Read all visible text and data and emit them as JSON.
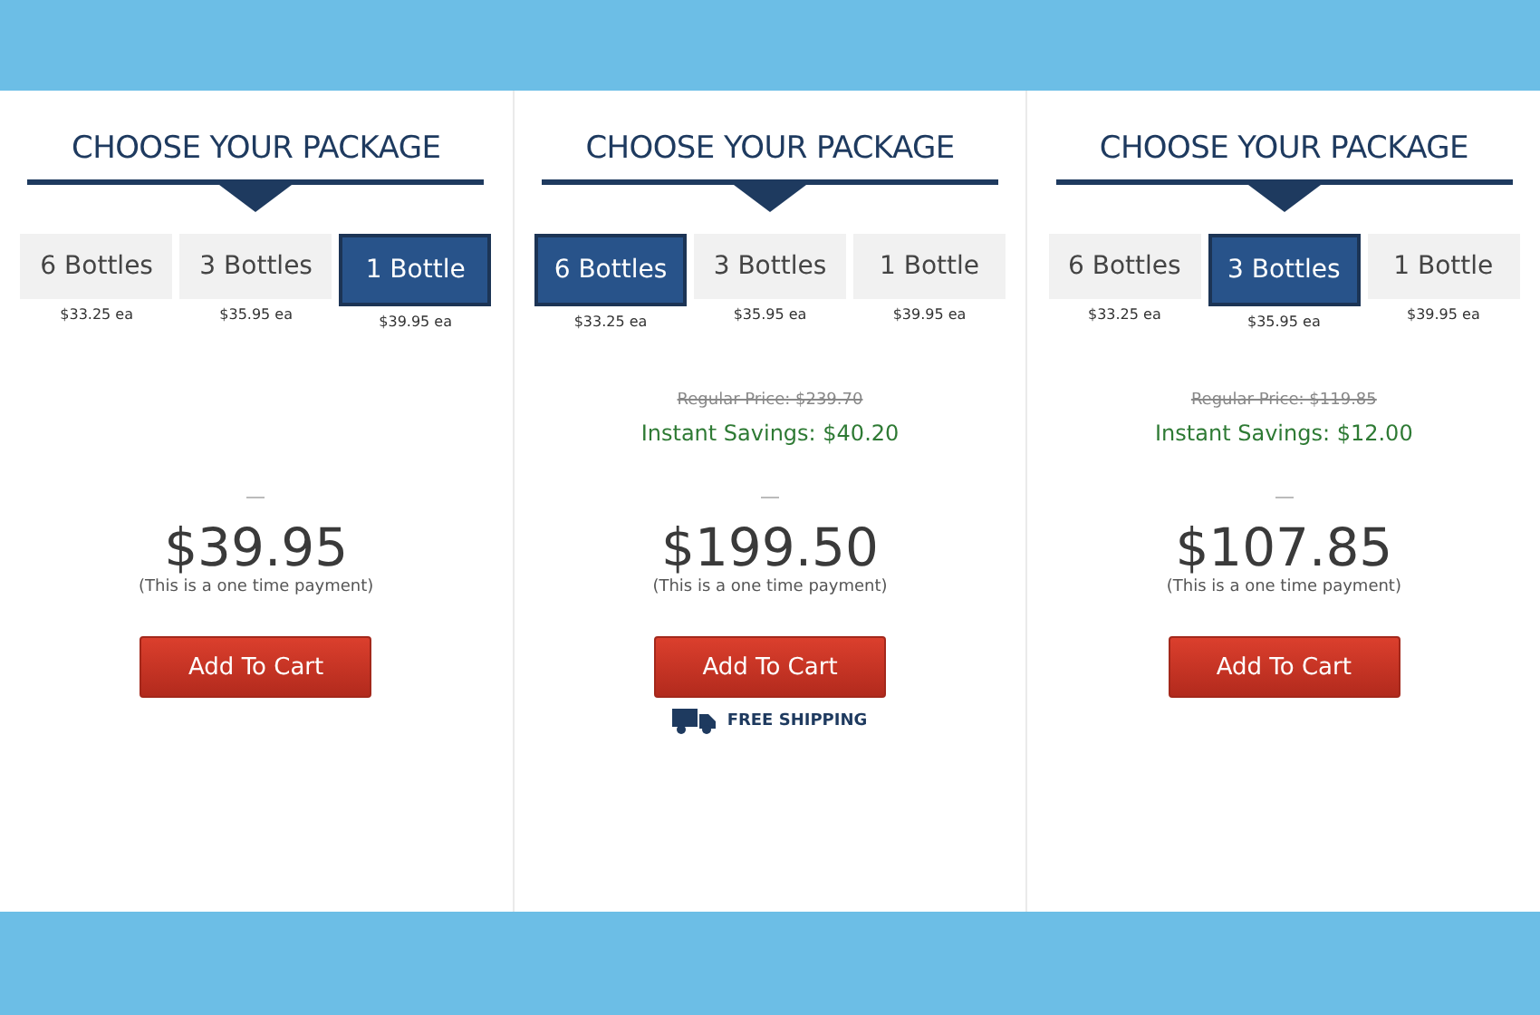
{
  "panels": [
    {
      "heading": "CHOOSE YOUR PACKAGE",
      "options": [
        {
          "label": "6 Bottles",
          "per_unit": "$33.25 ea",
          "selected": false
        },
        {
          "label": "3 Bottles",
          "per_unit": "$35.95 ea",
          "selected": false
        },
        {
          "label": "1 Bottle",
          "per_unit": "$39.95 ea",
          "selected": true
        }
      ],
      "price": "$39.95",
      "note": "(This is a one time payment)",
      "button": "Add To Cart"
    },
    {
      "heading": "CHOOSE YOUR PACKAGE",
      "options": [
        {
          "label": "6 Bottles",
          "per_unit": "$33.25 ea",
          "selected": true
        },
        {
          "label": "3 Bottles",
          "per_unit": "$35.95 ea",
          "selected": false
        },
        {
          "label": "1 Bottle",
          "per_unit": "$39.95 ea",
          "selected": false
        }
      ],
      "regular_price": "Regular Price: $239.70",
      "savings": "Instant Savings: $40.20",
      "price": "$199.50",
      "note": "(This is a one time payment)",
      "button": "Add To Cart",
      "shipping": "FREE SHIPPING"
    },
    {
      "heading": "CHOOSE YOUR PACKAGE",
      "options": [
        {
          "label": "6 Bottles",
          "per_unit": "$33.25 ea",
          "selected": false
        },
        {
          "label": "3 Bottles",
          "per_unit": "$35.95 ea",
          "selected": true
        },
        {
          "label": "1 Bottle",
          "per_unit": "$39.95 ea",
          "selected": false
        }
      ],
      "regular_price": "Regular Price: $119.85",
      "savings": "Instant Savings: $12.00",
      "price": "$107.85",
      "note": "(This is a one time payment)",
      "button": "Add To Cart"
    }
  ]
}
